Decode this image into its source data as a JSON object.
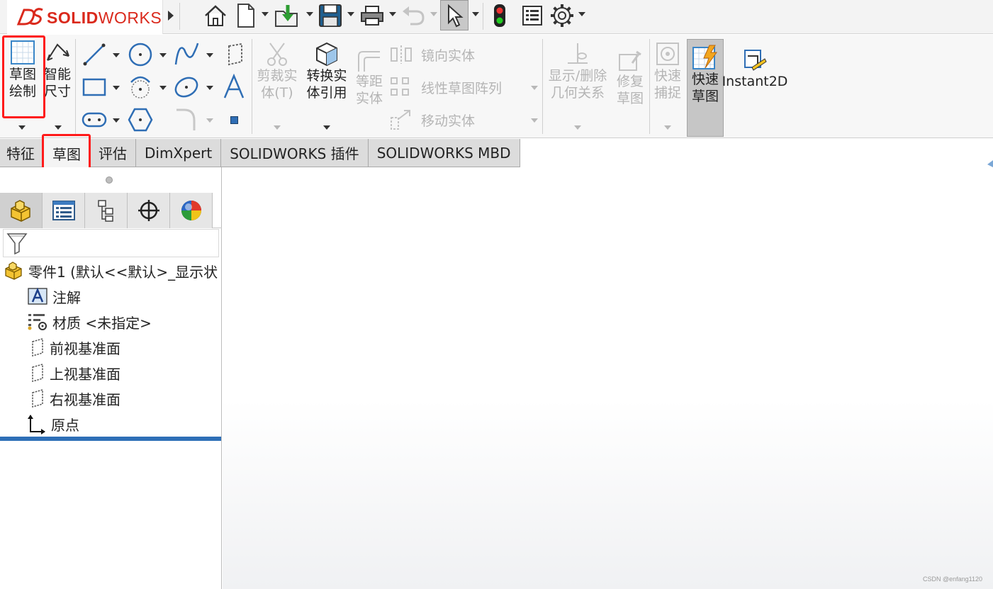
{
  "app": {
    "logo_brand": "SOLIDWORKS",
    "accent_color": "#da291c",
    "highlight_color": "#ff1a1a"
  },
  "quick_access": {
    "items": [
      {
        "icon": "expand-arrow-icon"
      },
      {
        "icon": "home-icon"
      },
      {
        "icon": "new-document-icon"
      },
      {
        "icon": "open-icon"
      },
      {
        "icon": "save-icon"
      },
      {
        "icon": "print-icon"
      },
      {
        "icon": "undo-icon"
      },
      {
        "icon": "select-icon"
      },
      {
        "icon": "rebuild-icon"
      },
      {
        "icon": "file-properties-icon"
      },
      {
        "icon": "options-gear-icon"
      }
    ]
  },
  "command_manager": {
    "sketch": {
      "label": "草图\n绘制",
      "highlighted": true
    },
    "smart_dimension": {
      "label": "智能\n尺寸"
    },
    "trim_entities": {
      "label": "剪裁实\n体(T)",
      "enabled": false
    },
    "convert_entities": {
      "label": "转换实\n体引用",
      "enabled": true
    },
    "offset_entities": {
      "label": "等距\n实体",
      "enabled": false
    },
    "mirror_entities": {
      "label": "镜向实体",
      "enabled": false
    },
    "linear_pattern": {
      "label": "线性草图阵列",
      "enabled": false
    },
    "move_entities": {
      "label": "移动实体",
      "enabled": false
    },
    "display_relations": {
      "label": "显示/删除\n几何关系",
      "enabled": false
    },
    "repair_sketch": {
      "label": "修复\n草图",
      "enabled": false
    },
    "quick_snaps": {
      "label": "快速\n捕捉",
      "enabled": false
    },
    "rapid_sketch": {
      "label": "快速\n草图",
      "pressed": true
    },
    "instant2d": {
      "label": "Instant2D"
    }
  },
  "tabs": [
    {
      "label": "特征",
      "active": false
    },
    {
      "label": "草图",
      "active": true
    },
    {
      "label": "评估",
      "active": false
    },
    {
      "label": "DimXpert",
      "active": false
    },
    {
      "label": "SOLIDWORKS 插件",
      "active": false
    },
    {
      "label": "SOLIDWORKS MBD",
      "active": false
    }
  ],
  "feature_manager": {
    "panel_tabs": [
      {
        "icon": "feature-manager-icon"
      },
      {
        "icon": "property-manager-icon"
      },
      {
        "icon": "configuration-manager-icon"
      },
      {
        "icon": "dimxpert-manager-icon"
      },
      {
        "icon": "display-manager-icon"
      }
    ],
    "filter_icon": "filter-icon",
    "tree": [
      {
        "label": "零件1  (默认<<默认>_显示状",
        "icon": "part-icon"
      },
      {
        "label": "注解",
        "icon": "annotations-icon"
      },
      {
        "label": "材质 <未指定>",
        "icon": "material-icon"
      },
      {
        "label": "前视基准面",
        "icon": "plane-icon"
      },
      {
        "label": "上视基准面",
        "icon": "plane-icon"
      },
      {
        "label": "右视基准面",
        "icon": "plane-icon"
      },
      {
        "label": "原点",
        "icon": "origin-icon"
      }
    ]
  },
  "watermark": "CSDN @enfang1120"
}
